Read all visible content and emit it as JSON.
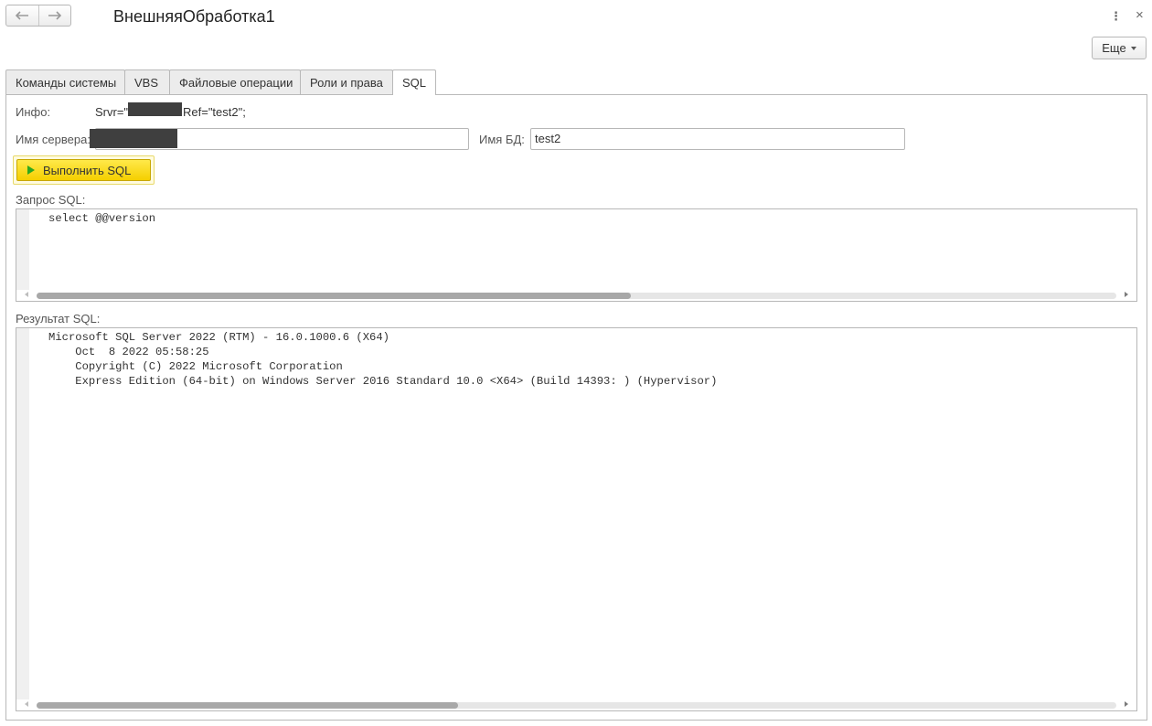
{
  "header": {
    "title": "ВнешняяОбработка1",
    "back_icon": "arrow-left-icon",
    "forward_icon": "arrow-right-icon",
    "menu_icon": "⋮",
    "close_icon": "×",
    "more_label": "Еще"
  },
  "tabs": [
    {
      "label": "Команды системы",
      "active": false
    },
    {
      "label": "VBS",
      "active": false
    },
    {
      "label": "Файловые операции",
      "active": false
    },
    {
      "label": "Роли и права",
      "active": false
    },
    {
      "label": "SQL",
      "active": true
    }
  ],
  "info": {
    "label": "Инфо:",
    "prefix": "Srvr=\"",
    "suffix": "Ref=\"test2\";"
  },
  "server": {
    "label": "Имя сервера:",
    "value": ""
  },
  "db": {
    "label": "Имя БД:",
    "value": "test2"
  },
  "run_button": {
    "label": "Выполнить SQL",
    "icon": "play-icon",
    "accent": "#f5d100"
  },
  "query": {
    "label": "Запрос SQL:",
    "text": "select @@version",
    "scroll_fraction": 0.55
  },
  "result": {
    "label": "Результат SQL:",
    "text": "Microsoft SQL Server 2022 (RTM) - 16.0.1000.6 (X64)\n\tOct  8 2022 05:58:25\n\tCopyright (C) 2022 Microsoft Corporation\n\tExpress Edition (64-bit) on Windows Server 2016 Standard 10.0 <X64> (Build 14393: ) (Hypervisor)",
    "scroll_fraction": 0.39
  }
}
